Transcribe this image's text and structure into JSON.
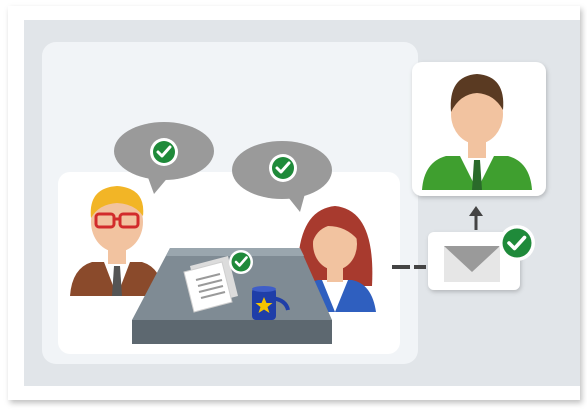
{
  "colors": {
    "outer_frame": "#ffffff",
    "background_panel": "#e1e5e9",
    "meeting_panel": "#f1f4f7",
    "card": "#ffffff",
    "speech_bubble": "#9a9a9a",
    "check_green": "#1f8a3a",
    "table_top": "#7f8b94",
    "table_side": "#5d6870",
    "skin": "#f2c3a0",
    "suit_brown": "#8a4a2b",
    "suit_blue": "#2f5fbf",
    "suit_green": "#3f9f2f",
    "hair_brown": "#5a3a22",
    "hair_blond": "#f2b526",
    "hair_red": "#a83a2e",
    "glasses_red": "#d22b2b",
    "mug_blue": "#1f3ea8",
    "star_yellow": "#f5c400",
    "connector": "#444444"
  },
  "icons": [
    "speech-bubble-icon",
    "check-circle-icon",
    "document-icon",
    "mug-icon",
    "envelope-icon",
    "arrow-up-icon",
    "person-icon"
  ],
  "people": [
    {
      "name": "man-with-glasses",
      "suit": "brown",
      "hair": "blond",
      "approved": true
    },
    {
      "name": "woman",
      "suit": "blue",
      "hair": "red",
      "approved": true
    },
    {
      "name": "recipient-man",
      "suit": "green",
      "hair": "brown",
      "approved": false
    }
  ],
  "document_approved": true,
  "envelope_approved": true
}
